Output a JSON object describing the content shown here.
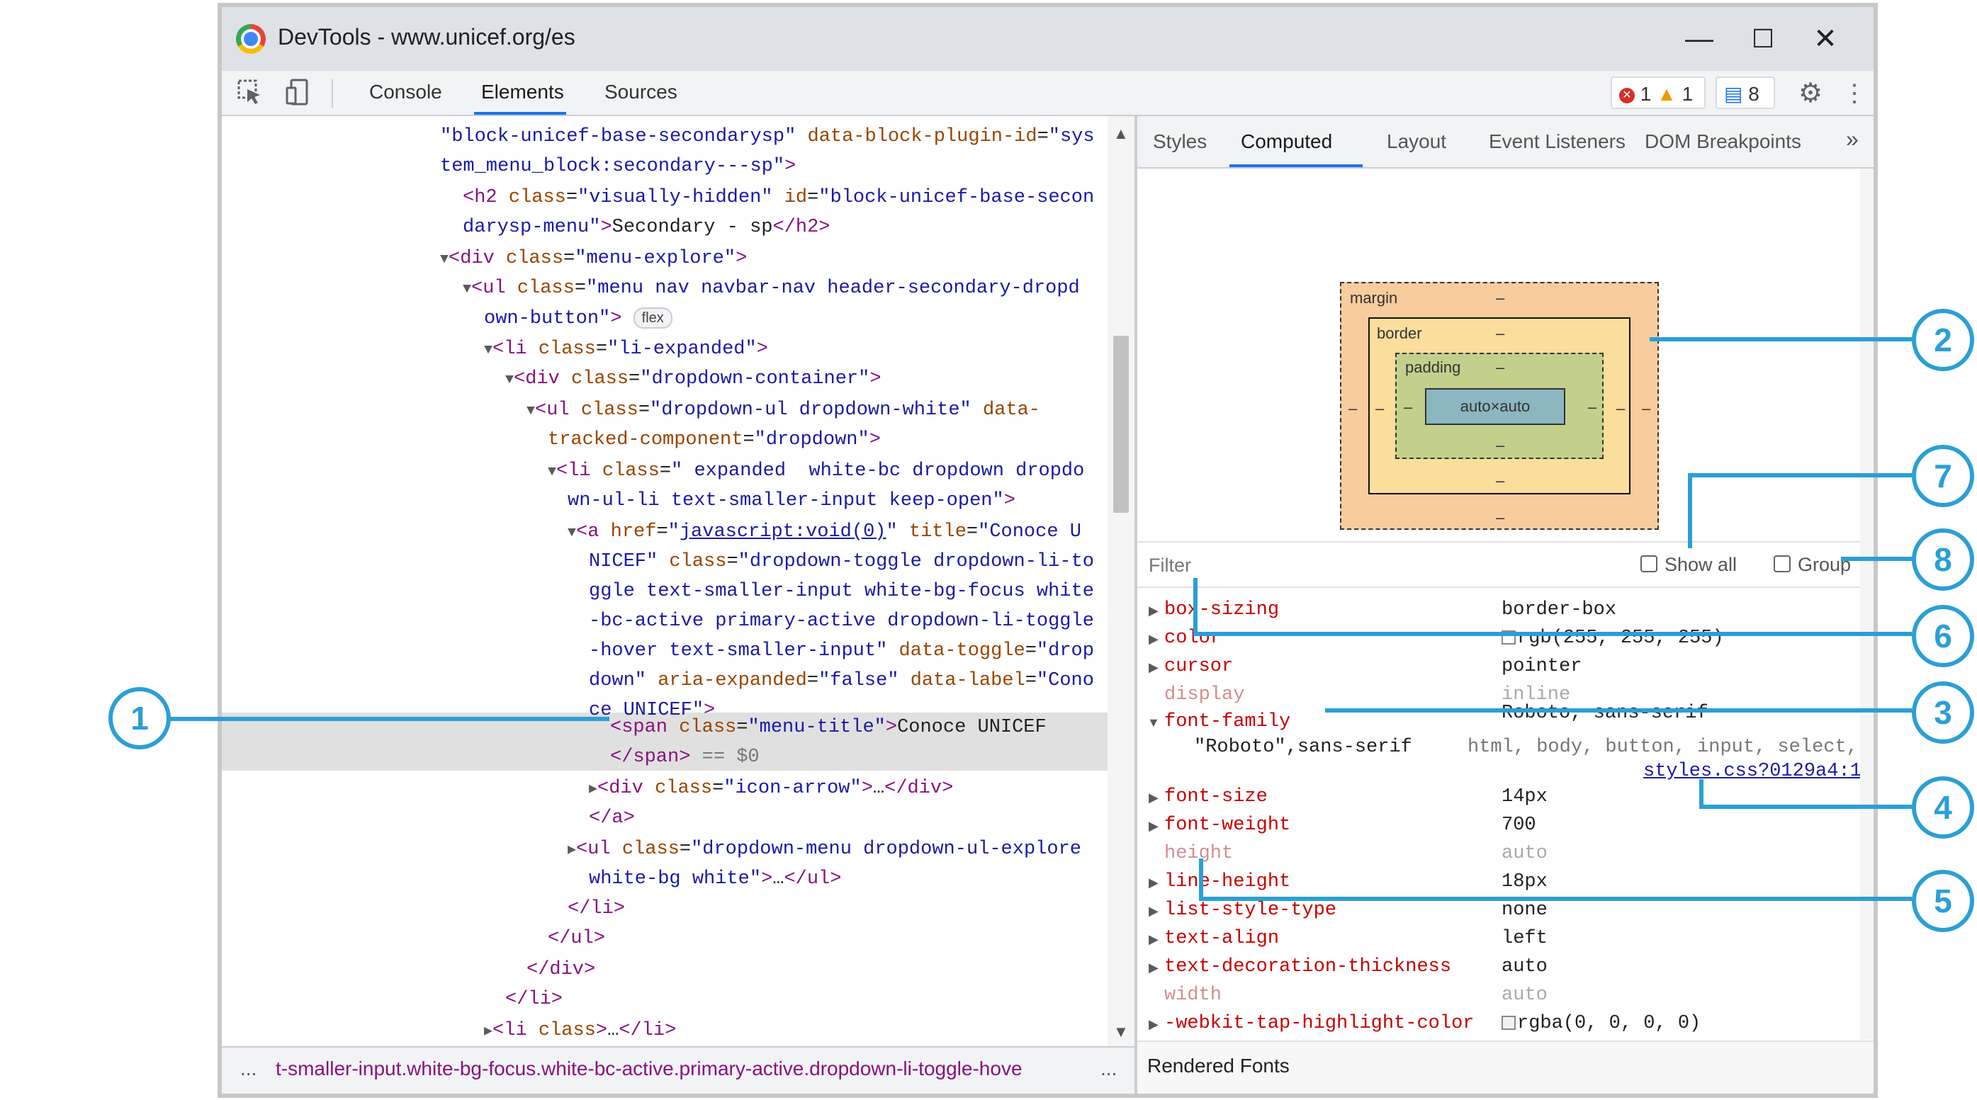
{
  "window": {
    "title": "DevTools - www.unicef.org/es",
    "minimize": "—",
    "maximize": "☐",
    "close": "✕"
  },
  "toolbar": {
    "inspect_icon": "inspect-element-icon",
    "device_icon": "device-toggle-icon",
    "tabs": [
      {
        "label": "Console",
        "active": false
      },
      {
        "label": "Elements",
        "active": true
      },
      {
        "label": "Sources",
        "active": false
      }
    ],
    "errors": "1",
    "warnings": "1",
    "messages": "8",
    "settings_icon": "gear-icon",
    "more_icon": "⋮"
  },
  "elements": {
    "lines": [
      {
        "t": "\"block-unicef-base-secondarysp\" data-block-plugin-id=\"sys"
      },
      {
        "t": "tem_menu_block:secondary---sp\">"
      },
      {
        "t": "<h2 class=\"visually-hidden\" id=\"block-unicef-base-secon"
      },
      {
        "t": "darysp-menu\">Secondary - sp</h2>"
      },
      {
        "t": "▼<div class=\"menu-explore\">"
      },
      {
        "t": "▼<ul class=\"menu nav navbar-nav header-secondary-dropd"
      },
      {
        "t": "own-button\">"
      },
      {
        "t": "▼<li class=\"li-expanded\">"
      },
      {
        "t": "▼<div class=\"dropdown-container\">"
      },
      {
        "t": "▼<ul class=\"dropdown-ul dropdown-white\" data-"
      },
      {
        "t": "tracked-component=\"dropdown\">"
      },
      {
        "t": "▼<li class=\" expanded  white-bc dropdown dropdo"
      },
      {
        "t": "wn-ul-li text-smaller-input keep-open\">"
      },
      {
        "t": "▼<a href=\"javascript:void(0)\" title=\"Conoce U"
      },
      {
        "t": "NICEF\" class=\"dropdown-toggle dropdown-li-to"
      },
      {
        "t": "ggle text-smaller-input white-bg-focus white"
      },
      {
        "t": "-bc-active primary-active dropdown-li-toggle"
      },
      {
        "t": "-hover text-smaller-input\" data-toggle=\"drop"
      },
      {
        "t": "down\" aria-expanded=\"false\" data-label=\"Cono"
      },
      {
        "t": "ce UNICEF\">"
      },
      {
        "t": "<span class=\"menu-title\">Conoce UNICEF"
      },
      {
        "t": "</span> == $0"
      },
      {
        "t": "▶<div class=\"icon-arrow\">…</div>"
      },
      {
        "t": "</a>"
      },
      {
        "t": "▶<ul class=\"dropdown-menu dropdown-ul-explore"
      },
      {
        "t": "white-bg white\">…</ul>"
      },
      {
        "t": "</li>"
      },
      {
        "t": "</ul>"
      },
      {
        "t": "</div>"
      },
      {
        "t": "</li>"
      },
      {
        "t": "▶<li class>…</li>"
      }
    ],
    "flex_badge": "flex",
    "href_value": "javascript:void(0)",
    "selected_marker": "== $0"
  },
  "breadcrumb": {
    "left_ellipsis": "...",
    "text": "t-smaller-input.white-bg-focus.white-bc-active.primary-active.dropdown-li-toggle-hove",
    "right_ellipsis": "..."
  },
  "sidebar": {
    "tabs": [
      {
        "label": "Styles",
        "active": false
      },
      {
        "label": "Computed",
        "active": true
      },
      {
        "label": "Layout",
        "active": false
      },
      {
        "label": "Event Listeners",
        "active": false
      },
      {
        "label": "DOM Breakpoints",
        "active": false
      }
    ],
    "more_tabs": "»",
    "box_model": {
      "margin_label": "margin",
      "border_label": "border",
      "padding_label": "padding",
      "content": "auto×auto",
      "dash": "–"
    },
    "filter_placeholder": "Filter",
    "show_all_label": "Show all",
    "group_label": "Group",
    "properties": [
      {
        "name": "box-sizing",
        "value": "border-box",
        "dim": false,
        "expandable": true
      },
      {
        "name": "color",
        "value": "rgb(255, 255, 255)",
        "dim": false,
        "expandable": true,
        "swatch": "#ffffff"
      },
      {
        "name": "cursor",
        "value": "pointer",
        "dim": false,
        "expandable": true
      },
      {
        "name": "display",
        "value": "inline",
        "dim": true,
        "expandable": false
      },
      {
        "name": "font-family",
        "value": "Roboto, sans-serif",
        "dim": false,
        "expandable": true,
        "expanded": true
      },
      {
        "name": "font-size",
        "value": "14px",
        "dim": false,
        "expandable": true
      },
      {
        "name": "font-weight",
        "value": "700",
        "dim": false,
        "expandable": true
      },
      {
        "name": "height",
        "value": "auto",
        "dim": true,
        "expandable": false
      },
      {
        "name": "line-height",
        "value": "18px",
        "dim": false,
        "expandable": true
      },
      {
        "name": "list-style-type",
        "value": "none",
        "dim": false,
        "expandable": true
      },
      {
        "name": "text-align",
        "value": "left",
        "dim": false,
        "expandable": true
      },
      {
        "name": "text-decoration-thickness",
        "value": "auto",
        "dim": false,
        "expandable": true
      },
      {
        "name": "width",
        "value": "auto",
        "dim": true,
        "expandable": false
      },
      {
        "name": "-webkit-tap-highlight-color",
        "value": "rgba(0, 0, 0, 0)",
        "dim": false,
        "expandable": true,
        "swatch": "#f2f2f2"
      }
    ],
    "font_family_detail": {
      "value": "\"Roboto\",sans-serif",
      "selector": "html, body, button, input, select,",
      "source": "styles.css?0129a4:1"
    },
    "rendered_fonts": "Rendered Fonts"
  },
  "callouts": [
    "1",
    "2",
    "3",
    "4",
    "5",
    "6",
    "7",
    "8"
  ],
  "colors": {
    "accent": "#1a73e8",
    "callout": "#2b9fd6",
    "tag": "#881280",
    "attr": "#994500",
    "value": "#1a1aa6",
    "property": "#c80000",
    "margin": "#f9cc9d",
    "border": "#fbdd9c",
    "padding": "#c3d08b",
    "content": "#8cb6c0"
  }
}
